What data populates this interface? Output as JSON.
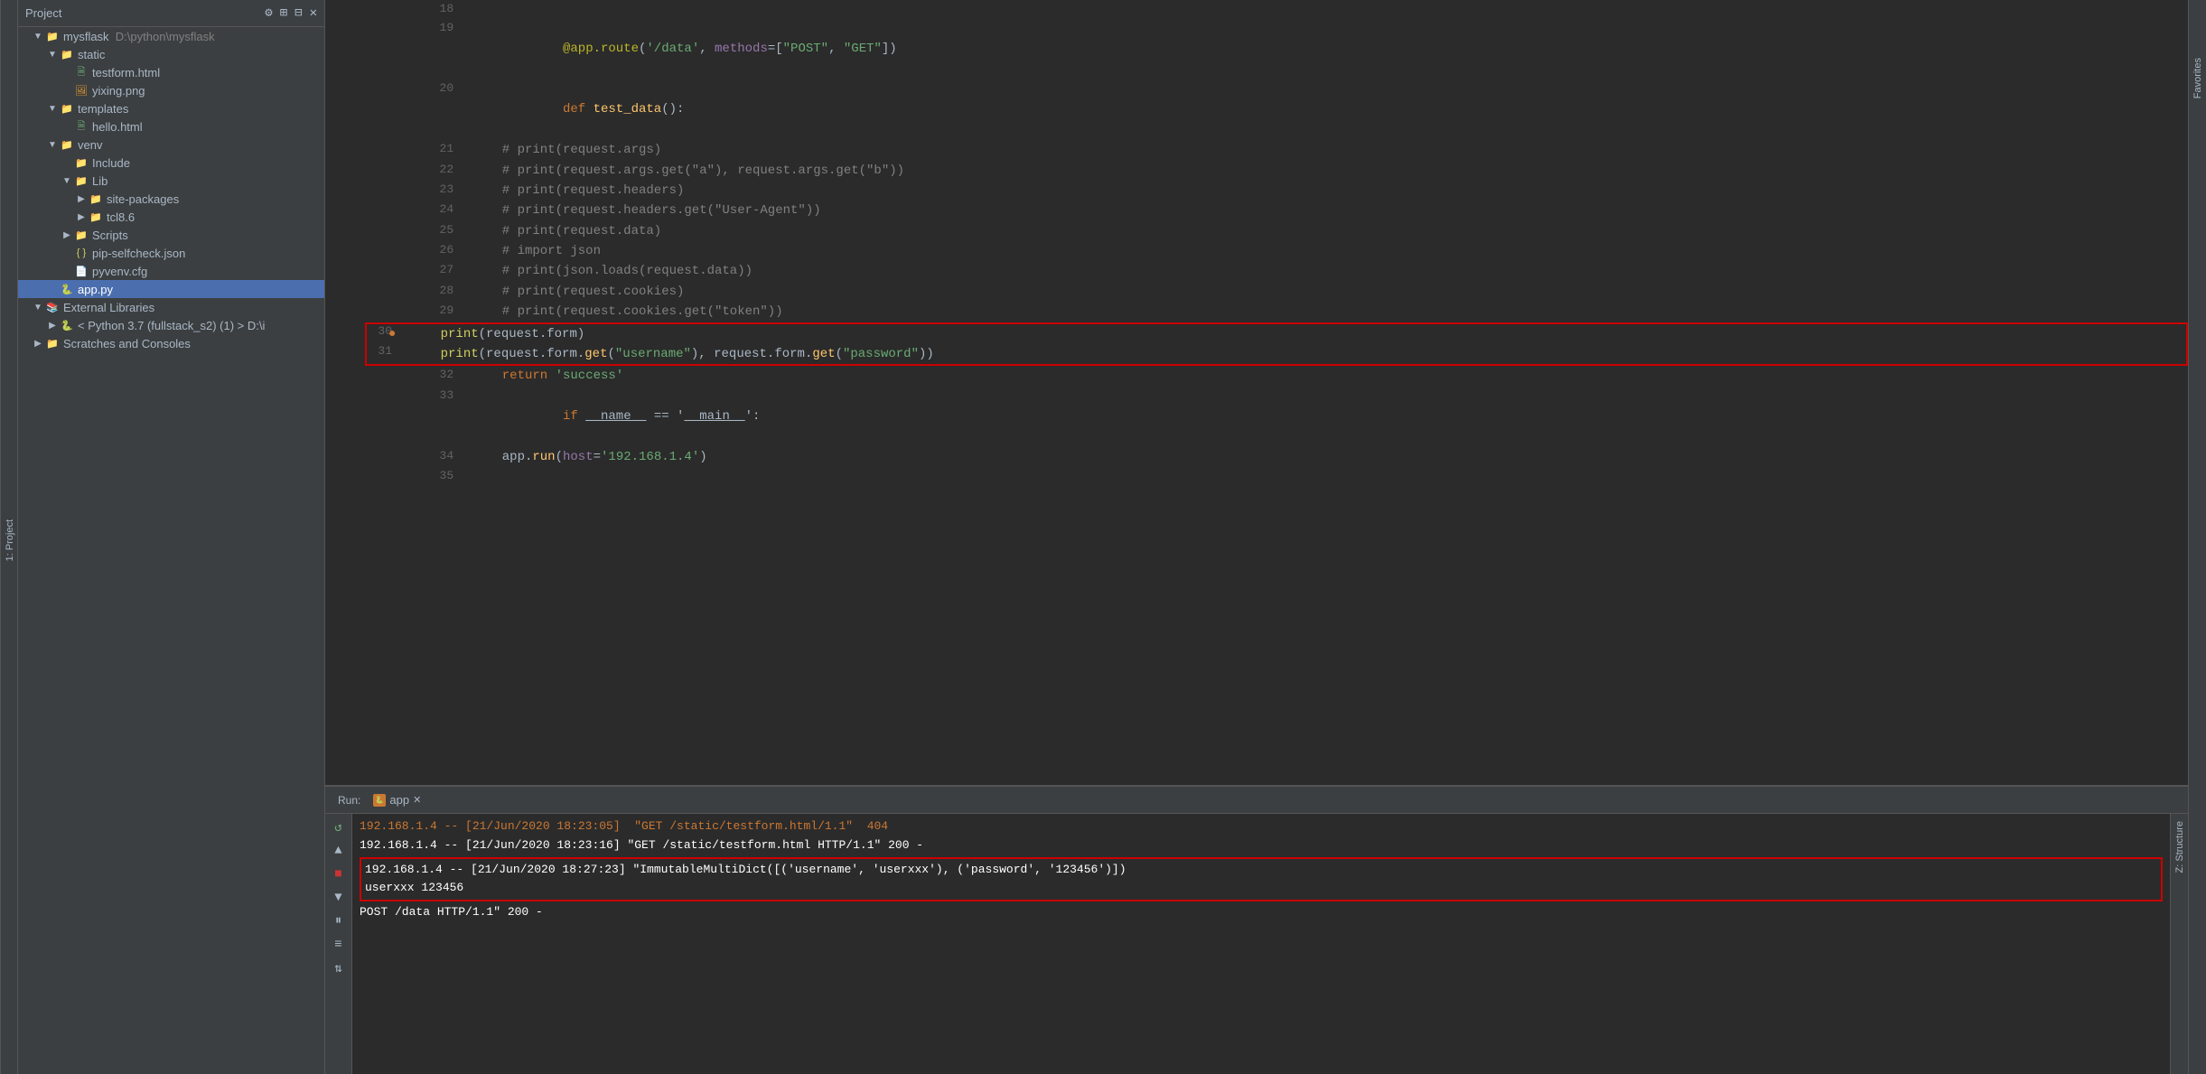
{
  "sidebar": {
    "project_label": "Project",
    "top_icons": [
      "⚙",
      "⊞",
      "⊟"
    ],
    "tree": [
      {
        "id": "mysflask",
        "level": 0,
        "label": "mysflask  D:\\python\\mysflask",
        "icon": "folder",
        "arrow": "▼",
        "color": "project"
      },
      {
        "id": "static",
        "level": 1,
        "label": "static",
        "icon": "folder",
        "arrow": "▼",
        "color": "blue-folder"
      },
      {
        "id": "testform",
        "level": 2,
        "label": "testform.html",
        "icon": "html",
        "arrow": "",
        "color": "green"
      },
      {
        "id": "yixing",
        "level": 2,
        "label": "yixing.png",
        "icon": "image",
        "arrow": "",
        "color": "orange"
      },
      {
        "id": "templates",
        "level": 1,
        "label": "templates",
        "icon": "folder",
        "arrow": "▼",
        "color": "purple"
      },
      {
        "id": "hello",
        "level": 2,
        "label": "hello.html",
        "icon": "html",
        "arrow": "",
        "color": "green"
      },
      {
        "id": "venv",
        "level": 1,
        "label": "venv",
        "icon": "folder",
        "arrow": "▼",
        "color": "orange"
      },
      {
        "id": "include",
        "level": 2,
        "label": "Include",
        "icon": "folder",
        "arrow": "",
        "color": "yellow"
      },
      {
        "id": "lib",
        "level": 2,
        "label": "Lib",
        "icon": "folder",
        "arrow": "▼",
        "color": "orange"
      },
      {
        "id": "site-packages",
        "level": 3,
        "label": "site-packages",
        "icon": "folder",
        "arrow": "▶",
        "color": "orange"
      },
      {
        "id": "tcl86",
        "level": 3,
        "label": "tcl8.6",
        "icon": "folder",
        "arrow": "▶",
        "color": "orange"
      },
      {
        "id": "scripts",
        "level": 2,
        "label": "Scripts",
        "icon": "folder",
        "arrow": "▶",
        "color": "yellow"
      },
      {
        "id": "pip-selfcheck",
        "level": 2,
        "label": "pip-selfcheck.json",
        "icon": "json",
        "arrow": "",
        "color": "yellow"
      },
      {
        "id": "pyvenv",
        "level": 2,
        "label": "pyvenv.cfg",
        "icon": "cfg",
        "arrow": "",
        "color": "gray"
      },
      {
        "id": "apppy",
        "level": 1,
        "label": "app.py",
        "icon": "py",
        "arrow": "",
        "color": "blue",
        "selected": true
      },
      {
        "id": "external-libs",
        "level": 0,
        "label": "External Libraries",
        "icon": "folder",
        "arrow": "▼",
        "color": "gray"
      },
      {
        "id": "python37",
        "level": 1,
        "label": "< Python 3.7 (fullstack_s2) (1) > D:\\i",
        "icon": "python",
        "arrow": "▶",
        "color": "green"
      },
      {
        "id": "scratches",
        "level": 0,
        "label": "Scratches and Consoles",
        "icon": "folder",
        "arrow": "▶",
        "color": "gray"
      }
    ]
  },
  "editor": {
    "lines": [
      {
        "num": 18,
        "tokens": []
      },
      {
        "num": 19,
        "content": "@app.route('/data', methods=[\"POST\", \"GET\"])"
      },
      {
        "num": 20,
        "content": "def test_data():"
      },
      {
        "num": 21,
        "content": "    # print(request.args)"
      },
      {
        "num": 22,
        "content": "    # print(request.args.get(\"a\"), request.args.get(\"b\"))"
      },
      {
        "num": 23,
        "content": "    # print(request.headers)"
      },
      {
        "num": 24,
        "content": "    # print(request.headers.get(\"User-Agent\"))"
      },
      {
        "num": 25,
        "content": "    # print(request.data)"
      },
      {
        "num": 26,
        "content": "    # import json"
      },
      {
        "num": 27,
        "content": "    # print(json.loads(request.data))"
      },
      {
        "num": 28,
        "content": "    # print(request.cookies)"
      },
      {
        "num": 29,
        "content": "    # print(request.cookies.get(\"token\"))"
      },
      {
        "num": 30,
        "content": "    print(request.form)",
        "boxed": true
      },
      {
        "num": 31,
        "content": "    print(request.form.get(\"username\"), request.form.get(\"password\"))",
        "boxed": true
      },
      {
        "num": 32,
        "content": "    return 'success'"
      },
      {
        "num": 33,
        "content": "if __name__ == '__main__':"
      },
      {
        "num": 34,
        "content": "    app.run(host='192.168.1.4')"
      },
      {
        "num": 35,
        "content": ""
      }
    ]
  },
  "console": {
    "tab_label": "app",
    "run_label": "Run:",
    "lines": [
      {
        "content": "192.168.1.4 -- [21/Jun/2020 18:23:05]  \"GET /static/testform.html/1.1\"  404",
        "color": "orange"
      },
      {
        "content": "192.168.1.4 -- [21/Jun/2020 18:23:16] \"GET /static/testform.html HTTP/1.1\" 200 -",
        "color": "white"
      },
      {
        "content": "192.168.1.4 -- [21/Jun/2020 18:27:23] \"ImmutableMultiDict([('username', 'userxxx'), ('password', '123456')])",
        "color": "white",
        "boxed": true
      },
      {
        "content": "userxxx 123456",
        "color": "white",
        "boxed_continue": true
      },
      {
        "content": "POST /data HTTP/1.1\" 200 -",
        "color": "white"
      }
    ]
  },
  "left_tabs": {
    "project_label": "1: Project",
    "structure_label": "Z: Structure",
    "favorites_label": "Favorites"
  }
}
